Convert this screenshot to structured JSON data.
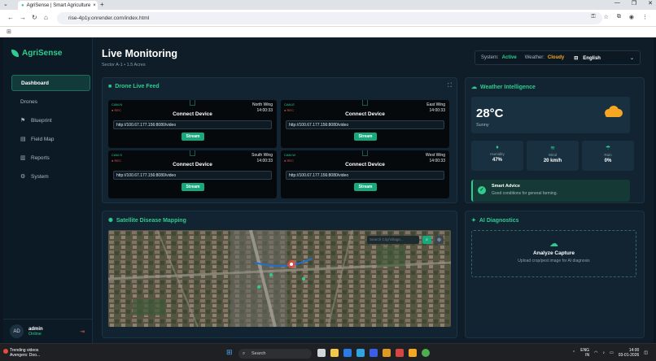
{
  "browser": {
    "tab_title": "AgriSense | Smart Agriculture",
    "url": "rise-4p1y.onrender.com/index.html",
    "new_tab": "+",
    "tab_close": "×"
  },
  "app": {
    "name": "AgriSense"
  },
  "sidebar": {
    "items": [
      {
        "label": "Dashboard",
        "icon": "dashboard-icon"
      },
      {
        "label": "Drones",
        "icon": "drone-icon"
      },
      {
        "label": "Blueprint",
        "icon": "blueprint-icon"
      },
      {
        "label": "Field Map",
        "icon": "map-icon"
      },
      {
        "label": "Reports",
        "icon": "reports-icon"
      },
      {
        "label": "System",
        "icon": "gear-icon"
      }
    ],
    "user": {
      "initials": "AD",
      "name": "admin",
      "status": "Online"
    }
  },
  "header": {
    "title": "Live Monitoring",
    "subtitle": "Sector A-1 • 1.5 Acres",
    "system_label": "System:",
    "system_value": "Active",
    "weather_label": "Weather:",
    "weather_value": "Cloudy",
    "language": "English"
  },
  "drone_feed": {
    "title": "Drone Live Feed",
    "cameras": [
      {
        "id": "CAM-N",
        "rec": "● REC",
        "wing": "North Wing",
        "time": "14:00:33",
        "action": "Connect Device",
        "url": "http://100.67.177.156:8080/video",
        "button": "Stream"
      },
      {
        "id": "CAM-E",
        "rec": "● REC",
        "wing": "East Wing",
        "time": "14:00:33",
        "action": "Connect Device",
        "url": "http://100.67.177.156:8080/video",
        "button": "Stream"
      },
      {
        "id": "CAM-S",
        "rec": "● REC",
        "wing": "South Wing",
        "time": "14:00:33",
        "action": "Connect Device",
        "url": "http://100.67.177.156:8080/video",
        "button": "Stream"
      },
      {
        "id": "CAM-W",
        "rec": "● REC",
        "wing": "West Wing",
        "time": "14:00:33",
        "action": "Connect Device",
        "url": "http://100.67.177.156:8080/video",
        "button": "Stream"
      }
    ]
  },
  "weather": {
    "title": "Weather Intelligence",
    "temperature": "28°C",
    "condition": "Sunny",
    "stats": [
      {
        "label": "Humidity",
        "value": "47%"
      },
      {
        "label": "Wind",
        "value": "20 km/h"
      },
      {
        "label": "Rain",
        "value": "0%"
      }
    ],
    "advice_title": "Smart Advice",
    "advice_text": "Good conditions for general farming."
  },
  "disease_map": {
    "title": "Satellite Disease Mapping",
    "search_placeholder": "Search City/Village..."
  },
  "diagnostics": {
    "title": "AI Diagnostics",
    "action": "Analyze Capture",
    "description": "Upload crop/pest image for AI diagnosis"
  },
  "taskbar": {
    "news_title": "Trending videos",
    "news_sub": "Avengers: Doo...",
    "search": "Search",
    "lang_top": "ENG",
    "lang_bottom": "IN",
    "time": "14:00",
    "date": "03-01-2026"
  }
}
